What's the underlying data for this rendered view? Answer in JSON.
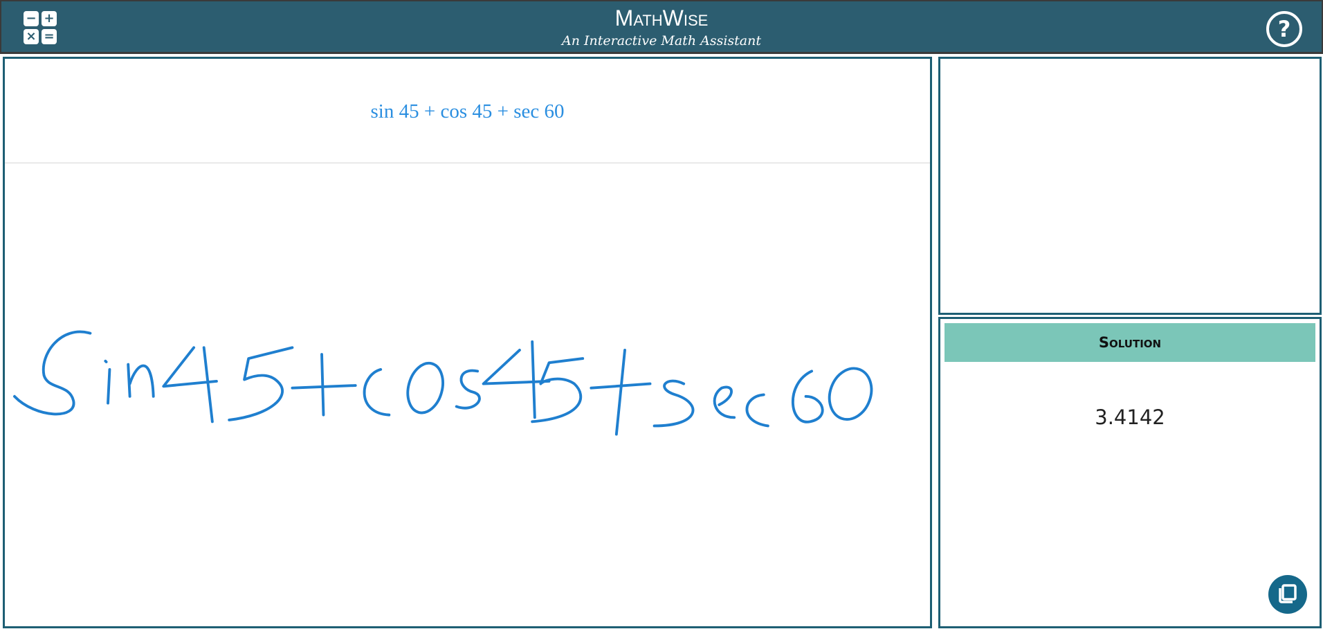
{
  "header": {
    "title": "MathWise",
    "subtitle": "An Interactive Math Assistant",
    "calc_symbols": [
      "−",
      "+",
      "×",
      "="
    ],
    "help_symbol": "?"
  },
  "canvas": {
    "recognized_expression": "sin 45 + cos 45 + sec 60",
    "ink_color": "#1f7fcf"
  },
  "solution": {
    "label": "Solution",
    "value": "3.4142"
  },
  "colors": {
    "header": "#2c5d70",
    "panel_border": "#1d5e73",
    "solution_bar": "#7bc6b8",
    "copy_button": "#15688a"
  }
}
